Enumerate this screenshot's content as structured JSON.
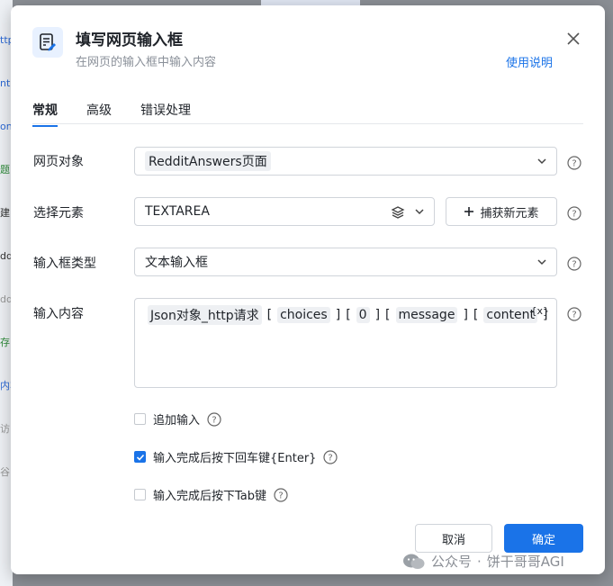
{
  "dialog": {
    "title": "填写网页输入框",
    "subtitle": "在网页的输入框中输入内容",
    "help_link": "使用说明",
    "icon": "edit-document-icon"
  },
  "tabs": [
    {
      "label": "常规",
      "active": true
    },
    {
      "label": "高级",
      "active": false
    },
    {
      "label": "错误处理",
      "active": false
    }
  ],
  "fields": {
    "web_object": {
      "label": "网页对象",
      "value": "RedditAnswers页面"
    },
    "select_element": {
      "label": "选择元素",
      "value": "TEXTAREA",
      "capture_button": "捕获新元素"
    },
    "input_type": {
      "label": "输入框类型",
      "value": "文本输入框"
    },
    "input_content": {
      "label": "输入内容",
      "tokens": [
        "Json对象_http请求",
        "choices",
        "0",
        "message",
        "content"
      ],
      "variable_icon": "{x}"
    }
  },
  "options": [
    {
      "label": "追加输入",
      "checked": false
    },
    {
      "label": "输入完成后按下回车键{Enter}",
      "checked": true
    },
    {
      "label": "输入完成后按下Tab键",
      "checked": false
    }
  ],
  "buttons": {
    "cancel": "取消",
    "ok": "确定"
  },
  "watermark": {
    "sep": "·",
    "account": "公众号",
    "name": "饼干哥哥AGI"
  },
  "colors": {
    "accent": "#1a73e8"
  },
  "background": {
    "left_fragments": [
      "ttp",
      "nth",
      "on",
      "题",
      "建",
      "dd",
      "dd",
      "存",
      "内容",
      "访",
      "谷"
    ]
  }
}
